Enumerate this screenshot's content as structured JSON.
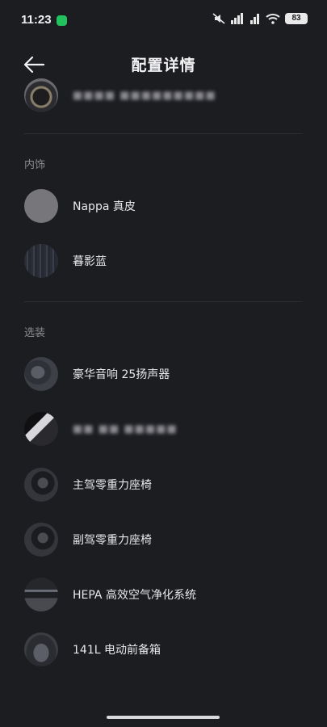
{
  "status_bar": {
    "time": "11:23",
    "battery": "83",
    "icons": [
      "wechat-icon",
      "mute-icon",
      "signal-4g-icon",
      "signal-icon",
      "wifi-icon",
      "battery-icon"
    ]
  },
  "header": {
    "title": "配置详情",
    "back_icon": "arrow-left-icon"
  },
  "top_item": {
    "label": "■■■■ ■■■■■■■■■",
    "thumb": "steering-wheel"
  },
  "interior": {
    "section_title": "内饰",
    "items": [
      {
        "label": "Nappa 真皮",
        "thumb": "leather-swatch"
      },
      {
        "label": "暮影蓝",
        "thumb": "fabric-swatch"
      }
    ]
  },
  "options": {
    "section_title": "选装",
    "items": [
      {
        "label": "豪华音响 25扬声器",
        "thumb": "speaker"
      },
      {
        "label": "■■ ■■ ■■■■■",
        "thumb": "screen"
      },
      {
        "label": "主驾零重力座椅",
        "thumb": "driver-seat"
      },
      {
        "label": "副驾零重力座椅",
        "thumb": "passenger-seat"
      },
      {
        "label": "HEPA 高效空气净化系统",
        "thumb": "air-filter"
      },
      {
        "label": "141L 电动前备箱",
        "thumb": "front-trunk"
      }
    ]
  },
  "colors": {
    "background": "#1c1d21",
    "text": "#e8e8ea",
    "muted": "#8b8b90",
    "divider": "#2c2d32"
  }
}
